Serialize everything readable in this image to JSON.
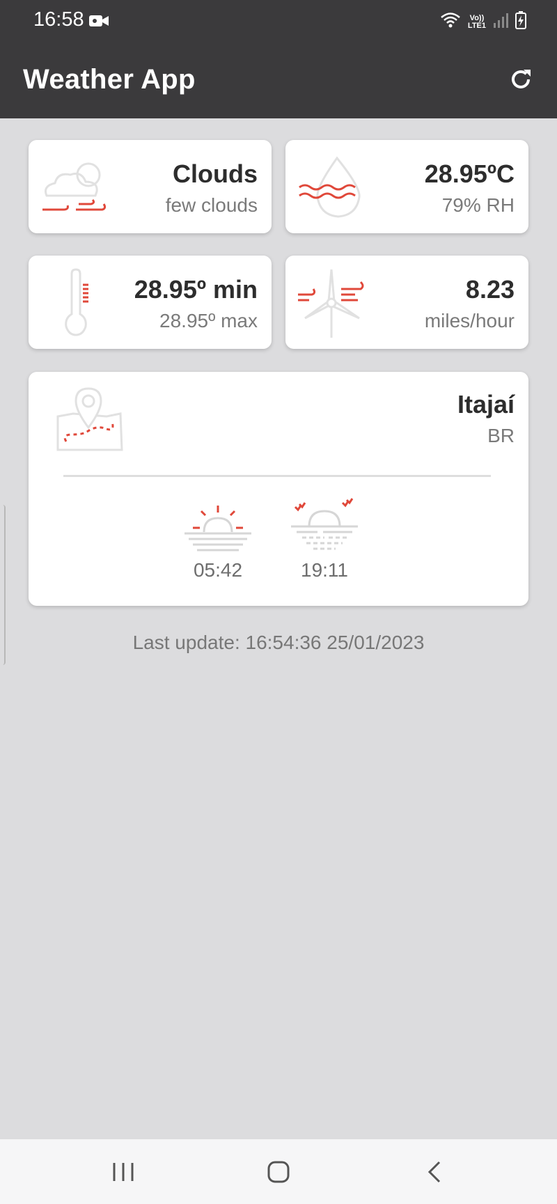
{
  "status_bar": {
    "time": "16:58",
    "network_line1": "Vo))",
    "network_line2": "LTE1"
  },
  "app_bar": {
    "title": "Weather App"
  },
  "cards": {
    "condition": {
      "main": "Clouds",
      "sub": "few clouds"
    },
    "temperature": {
      "main": "28.95ºC",
      "sub": "79% RH"
    },
    "minmax": {
      "main": "28.95º min",
      "sub": "28.95º max"
    },
    "wind": {
      "main": "8.23",
      "sub": "miles/hour"
    },
    "location": {
      "city": "Itajaí",
      "country": "BR",
      "sunrise": "05:42",
      "sunset": "19:11"
    }
  },
  "last_update": "Last update: 16:54:36 25/01/2023",
  "colors": {
    "accent": "#e0483a",
    "icon_gray": "#d4d4d4",
    "appbar": "#3b3a3c",
    "background": "#dcdcde"
  },
  "icons": {
    "camera": "video-camera-icon",
    "wifi": "wifi-icon",
    "signal": "signal-icon",
    "battery": "battery-charging-icon",
    "refresh": "refresh-icon",
    "clouds": "clouds-wind-icon",
    "humidity": "water-drop-icon",
    "thermometer": "thermometer-icon",
    "wind": "wind-turbine-icon",
    "map": "map-pin-icon",
    "sunrise": "sunrise-icon",
    "sunset": "sunset-icon"
  }
}
